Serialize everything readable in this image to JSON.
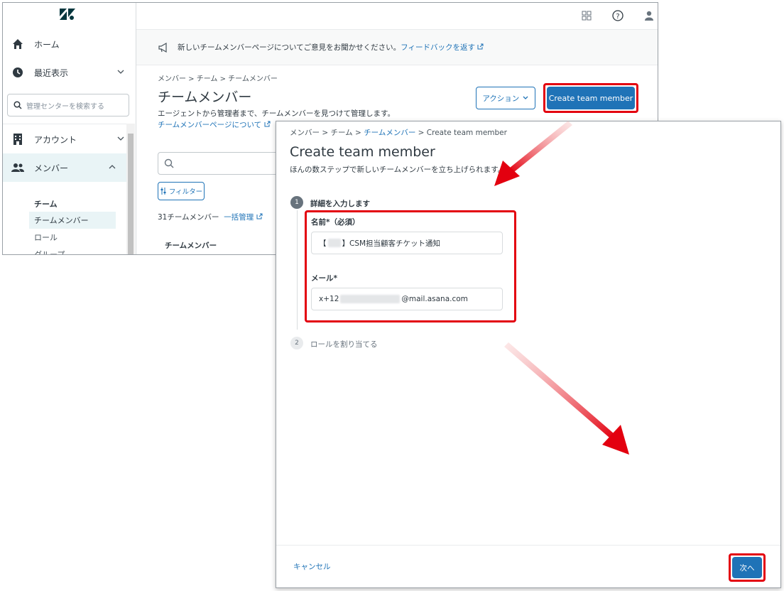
{
  "sidebar": {
    "home_label": "ホーム",
    "recent_label": "最近表示",
    "search_placeholder": "管理センターを検索する",
    "account_label": "アカウント",
    "members_label": "メンバー",
    "team_heading": "チーム",
    "sub_items": [
      "チームメンバー",
      "ロール",
      "グループ"
    ]
  },
  "banner": {
    "text": "新しいチームメンバーページについてご意見をお聞かせください。",
    "link": "フィードバックを返す"
  },
  "page": {
    "breadcrumb": "メンバー > チーム > チームメンバー",
    "title": "チームメンバー",
    "description": "エージェントから管理者まで、チームメンバーを見つけて管理します。",
    "about_link": "チームメンバーページについて",
    "action_button": "アクション",
    "create_button": "Create team member",
    "filter_button": "フィルター",
    "member_count": "31チームメンバー",
    "bulk_manage": "一括管理",
    "column_header": "チームメンバー"
  },
  "dialog": {
    "breadcrumb_plain": "メンバー > チーム > ",
    "breadcrumb_link": "チームメンバー",
    "breadcrumb_tail": " > Create team member",
    "title": "Create team member",
    "subtitle": "ほんの数ステップで新しいチームメンバーを立ち上げられます。",
    "step1_number": "1",
    "step1_label": "詳細を入力します",
    "name_label": "名前*（必須）",
    "name_prefix": "【",
    "name_suffix": "】CSM担当顧客チケット通知",
    "email_label": "メール*",
    "email_prefix": "x+12",
    "email_suffix": "@mail.asana.com",
    "step2_number": "2",
    "step2_label": "ロールを割り当てる",
    "cancel": "キャンセル",
    "next": "次へ"
  },
  "colors": {
    "accent": "#1f73b7",
    "highlight": "#e3000f",
    "active_bg": "#e9f4f6"
  }
}
